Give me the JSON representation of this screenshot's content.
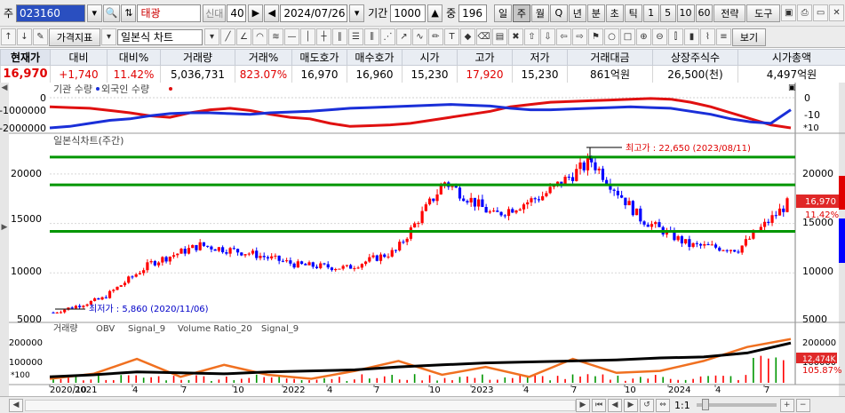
{
  "toolbar1": {
    "market_label": "주",
    "code": "023160",
    "stock_name": "태광",
    "new_btn": "신대",
    "period_num": "40",
    "date": "2024/07/26",
    "period_label": "기간",
    "period_value": "1000",
    "mid_label": "중",
    "mid_value": "196",
    "intervals": [
      "일",
      "주",
      "월",
      "Q",
      "년",
      "분",
      "초",
      "틱",
      "1",
      "5",
      "10",
      "60"
    ],
    "active_interval": "주",
    "strategy": "전략",
    "tools": "도구"
  },
  "toolbar2": {
    "indicator_btn": "가격지표",
    "chart_type": "일본식 차트",
    "view_btn": "보기"
  },
  "quote": {
    "headers": [
      "현재가",
      "대비",
      "대비%",
      "거래량",
      "거래%",
      "매도호가",
      "매수호가",
      "시가",
      "고가",
      "저가",
      "거래대금",
      "상장주식수",
      "시가총액"
    ],
    "values": [
      "16,970",
      "+1,740",
      "11.42%",
      "5,036,731",
      "823.07%",
      "16,970",
      "16,960",
      "15,230",
      "17,920",
      "15,230",
      "861억원",
      "26,500(천)",
      "4,497억원"
    ]
  },
  "panes": {
    "investor_title": "기관 수량",
    "investor_s2": "외국인 수량",
    "price_title": "일본식차트(주간)",
    "vol_title": "거래량",
    "vol_legend": [
      "OBV",
      "Signal_9",
      "Volume Ratio_20",
      "Signal_9"
    ]
  },
  "axes": {
    "inv_ticks": [
      "0",
      "-1000000",
      "-2000000"
    ],
    "inv_right": [
      "0",
      "-10"
    ],
    "inv_unit": "*10",
    "price_ticks": [
      "20000",
      "15000",
      "10000",
      "5000"
    ],
    "price_right": [
      "20000",
      "15000",
      "10000",
      "5000"
    ],
    "vol_ticks": [
      "200000",
      "100000"
    ],
    "vol_right": [
      "200000",
      "100000"
    ],
    "vol_unit": "*100",
    "x_ticks": [
      "2020/10",
      "2021",
      "4",
      "7",
      "10",
      "2022",
      "4",
      "7",
      "10",
      "2023",
      "4",
      "7",
      "10",
      "2024",
      "4",
      "7"
    ]
  },
  "annotations": {
    "high": "최고가 : 22,650 (2023/08/11)",
    "low": "최저가 : 5,860 (2020/11/06)",
    "last_price": "16,970",
    "last_pct": "11.42%",
    "vol_last": "12,474K",
    "vol_pct": "105.87%"
  },
  "colors": {
    "up": "#ff0000",
    "down": "#0000ff",
    "support": "#009600",
    "obv": "#000000",
    "ratio": "#f07020",
    "inst": "#e01010",
    "foreign": "#1a2fd8",
    "last_tag": "#e02828"
  },
  "bottom": {
    "zoom": "1:1"
  },
  "chart_data": [
    {
      "type": "line",
      "title": "",
      "series": [
        {
          "name": "기관 수량",
          "values": [
            -600000,
            -650000,
            -700000,
            -850000,
            -1000000,
            -1200000,
            -1300000,
            -1000000,
            -800000,
            -700000,
            -850000,
            -1100000,
            -1300000,
            -1400000,
            -1700000,
            -1900000,
            -1850000,
            -1800000,
            -1700000,
            -1500000,
            -1300000,
            -1100000,
            -900000,
            -600000,
            -450000,
            -300000,
            -250000,
            -200000,
            -150000,
            -100000,
            -50000,
            -100000,
            -300000,
            -600000,
            -1000000,
            -1400000,
            -1800000,
            -2000000
          ]
        },
        {
          "name": "외국인 수량",
          "values": [
            -2000000,
            -1900000,
            -1700000,
            -1500000,
            -1400000,
            -1200000,
            -1050000,
            -1000000,
            -1000000,
            -1050000,
            -1100000,
            -1000000,
            -950000,
            -900000,
            -800000,
            -700000,
            -650000,
            -600000,
            -550000,
            -500000,
            -450000,
            -500000,
            -550000,
            -700000,
            -800000,
            -800000,
            -750000,
            -700000,
            -650000,
            -600000,
            -650000,
            -700000,
            -900000,
            -1100000,
            -1400000,
            -1600000,
            -1700000,
            -800000
          ]
        }
      ],
      "ylim": [
        -2200000,
        250000
      ]
    },
    {
      "type": "candlestick",
      "title": "일본식차트(주간)",
      "x": [
        "2020/10",
        "2021/01",
        "2021/04",
        "2021/07",
        "2021/10",
        "2022/01",
        "2022/04",
        "2022/07",
        "2022/10",
        "2023/01",
        "2023/04",
        "2023/07",
        "2023/10",
        "2024/01",
        "2024/04",
        "2024/07"
      ],
      "close": [
        6000,
        7400,
        11000,
        12800,
        12000,
        10800,
        10500,
        12200,
        19200,
        15800,
        17800,
        21300,
        15500,
        12800,
        12400,
        16970
      ],
      "support_levels": [
        14200,
        18900,
        21700
      ],
      "ylim": [
        5000,
        22000
      ]
    },
    {
      "type": "line",
      "title": "거래량",
      "series": [
        {
          "name": "OBV",
          "values": [
            30000,
            40000,
            55000,
            50000,
            45000,
            55000,
            60000,
            65000,
            80000,
            90000,
            100000,
            105000,
            110000,
            115000,
            125000,
            130000,
            150000,
            200000
          ]
        },
        {
          "name": "Volume Ratio_20",
          "values": [
            20000,
            45000,
            120000,
            30000,
            90000,
            40000,
            20000,
            60000,
            110000,
            40000,
            80000,
            30000,
            120000,
            50000,
            60000,
            110000,
            180000,
            220000
          ]
        }
      ],
      "ylim": [
        0,
        250000
      ]
    }
  ]
}
